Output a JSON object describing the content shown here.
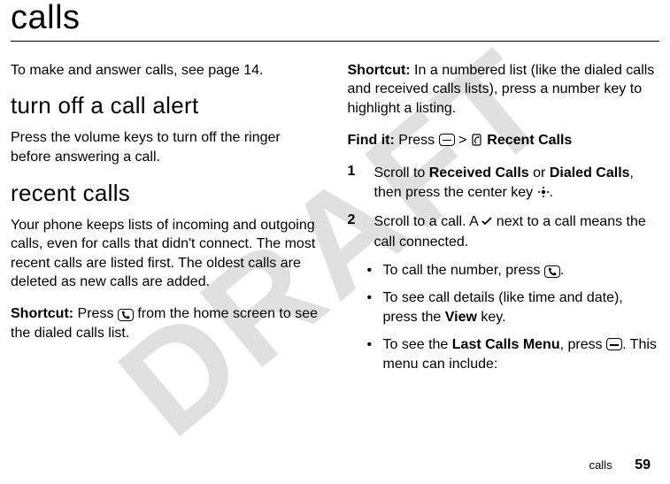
{
  "watermark": "DRAFT",
  "title": "calls",
  "left": {
    "intro": "To make and answer calls, see page 14.",
    "sec1_heading": "turn off a call alert",
    "sec1_body": "Press the volume keys to turn off the ringer before answering a call.",
    "sec2_heading": "recent calls",
    "sec2_body": "Your phone keeps lists of incoming and outgoing calls, even for calls that didn't connect. The most recent calls are listed first. The oldest calls are deleted as new calls are added.",
    "shortcut_label": "Shortcut:",
    "shortcut_a": " Press ",
    "shortcut_b": " from the home screen to see the dialed calls list."
  },
  "right": {
    "shortcut_label": "Shortcut:",
    "shortcut_body": " In a numbered list (like the dialed calls and received calls lists), press a number key to highlight a listing.",
    "findit_label": "Find it:",
    "findit_a": " Press ",
    "findit_gt": " > ",
    "findit_recent": " Recent Calls",
    "step1_num": "1",
    "step1_a": "Scroll to ",
    "step1_rc": "Received Calls",
    "step1_or": " or ",
    "step1_dc": "Dialed Calls",
    "step1_b": ", then press the center key ",
    "step1_c": ".",
    "step2_num": "2",
    "step2_a": "Scroll to a call. A ",
    "step2_b": " next to a call means the call connected.",
    "bullet1_a": "To call the number, press ",
    "bullet1_b": ".",
    "bullet2_a": "To see call details (like time and date), press the ",
    "bullet2_view": "View",
    "bullet2_b": " key.",
    "bullet3_a": "To see the ",
    "bullet3_lcm": "Last Calls Menu",
    "bullet3_b": ", press ",
    "bullet3_c": ". This menu can include:"
  },
  "footer": {
    "section": "calls",
    "page": "59"
  }
}
